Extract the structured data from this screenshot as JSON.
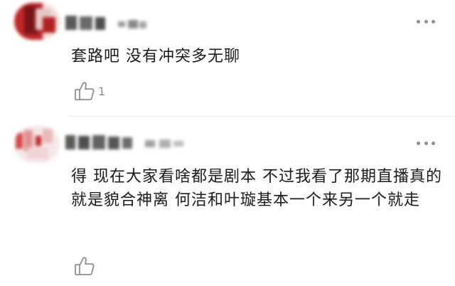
{
  "comments": [
    {
      "text": "套路吧 没有冲突多无聊",
      "like_count": "1",
      "like_icon": "thumbs-up-icon",
      "more_icon": "more-dots-icon"
    },
    {
      "text": "得 现在大家看啥都是剧本 不过我看了那期直播真的就是貌合神离 何洁和叶璇基本一个来另一个就走",
      "like_count": "",
      "like_icon": "thumbs-up-icon",
      "more_icon": "more-dots-icon"
    }
  ],
  "colors": {
    "avatar_red": "#c0282a",
    "icon_gray": "#8f8f8f",
    "divider": "#e6e6e6"
  }
}
